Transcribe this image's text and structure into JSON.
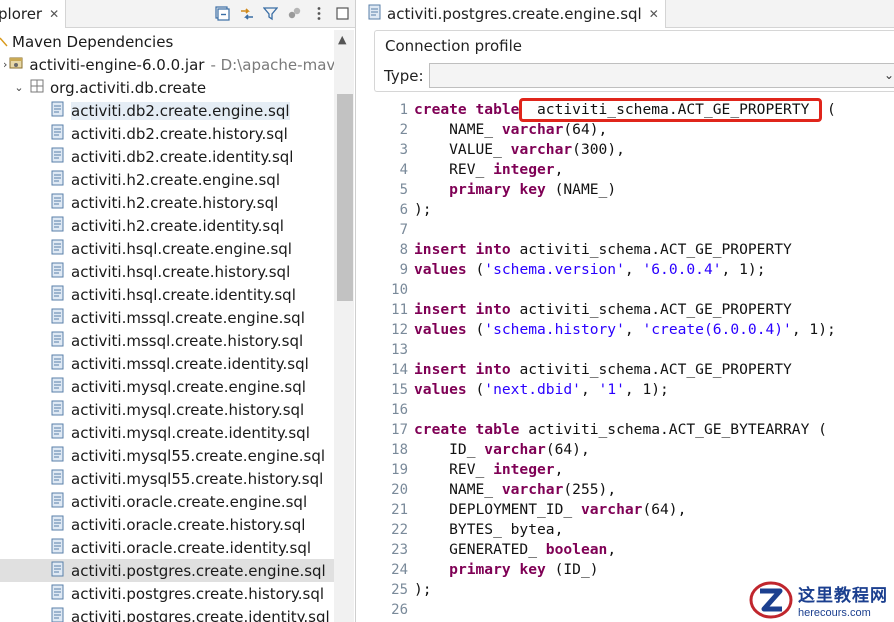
{
  "explorer": {
    "tab_title": "plorer",
    "tab_close": "✕",
    "tools": [
      "collapse-all-icon",
      "link-with-editor-icon",
      "filter-icon",
      "focus-icon",
      "view-menu-icon",
      "minimize-icon"
    ],
    "maven_label": "Maven Dependencies",
    "jar_label": "activiti-engine-6.0.0.jar",
    "jar_path": "- D:\\apache-maven",
    "package_label": "org.activiti.db.create",
    "files": [
      "activiti.db2.create.engine.sql",
      "activiti.db2.create.history.sql",
      "activiti.db2.create.identity.sql",
      "activiti.h2.create.engine.sql",
      "activiti.h2.create.history.sql",
      "activiti.h2.create.identity.sql",
      "activiti.hsql.create.engine.sql",
      "activiti.hsql.create.history.sql",
      "activiti.hsql.create.identity.sql",
      "activiti.mssql.create.engine.sql",
      "activiti.mssql.create.history.sql",
      "activiti.mssql.create.identity.sql",
      "activiti.mysql.create.engine.sql",
      "activiti.mysql.create.history.sql",
      "activiti.mysql.create.identity.sql",
      "activiti.mysql55.create.engine.sql",
      "activiti.mysql55.create.history.sql",
      "activiti.oracle.create.engine.sql",
      "activiti.oracle.create.history.sql",
      "activiti.oracle.create.identity.sql",
      "activiti.postgres.create.engine.sql",
      "activiti.postgres.create.history.sql",
      "activiti.postgres.create.identity.sql"
    ]
  },
  "editor": {
    "tab_title": "activiti.postgres.create.engine.sql",
    "tab_close": "✕",
    "connection_profile_label": "Connection profile",
    "type_label": "Type:",
    "type_value": "",
    "line_numbers": [
      "1",
      "2",
      "3",
      "4",
      "5",
      "6",
      "7",
      "8",
      "9",
      "10",
      "11",
      "12",
      "13",
      "14",
      "15",
      "16",
      "17",
      "18",
      "19",
      "20",
      "21",
      "22",
      "23",
      "24",
      "25",
      "26"
    ],
    "code": [
      [
        {
          "t": "kw",
          "v": "create table "
        },
        {
          "t": "p",
          "v": " activiti_schema.ACT_GE_PROPERTY  ("
        }
      ],
      [
        {
          "t": "p",
          "v": "    NAME_ "
        },
        {
          "t": "kw",
          "v": "varchar"
        },
        {
          "t": "p",
          "v": "(64),"
        }
      ],
      [
        {
          "t": "p",
          "v": "    VALUE_ "
        },
        {
          "t": "kw",
          "v": "varchar"
        },
        {
          "t": "p",
          "v": "(300),"
        }
      ],
      [
        {
          "t": "p",
          "v": "    REV_ "
        },
        {
          "t": "kw",
          "v": "integer"
        },
        {
          "t": "p",
          "v": ","
        }
      ],
      [
        {
          "t": "p",
          "v": "    "
        },
        {
          "t": "kw",
          "v": "primary key"
        },
        {
          "t": "p",
          "v": " (NAME_)"
        }
      ],
      [
        {
          "t": "p",
          "v": ");"
        }
      ],
      [],
      [
        {
          "t": "kw",
          "v": "insert into"
        },
        {
          "t": "p",
          "v": " activiti_schema.ACT_GE_PROPERTY"
        }
      ],
      [
        {
          "t": "kw",
          "v": "values"
        },
        {
          "t": "p",
          "v": " ("
        },
        {
          "t": "s",
          "v": "'schema.version'"
        },
        {
          "t": "p",
          "v": ", "
        },
        {
          "t": "s",
          "v": "'6.0.0.4'"
        },
        {
          "t": "p",
          "v": ", 1);"
        }
      ],
      [],
      [
        {
          "t": "kw",
          "v": "insert into"
        },
        {
          "t": "p",
          "v": " activiti_schema.ACT_GE_PROPERTY"
        }
      ],
      [
        {
          "t": "kw",
          "v": "values"
        },
        {
          "t": "p",
          "v": " ("
        },
        {
          "t": "s",
          "v": "'schema.history'"
        },
        {
          "t": "p",
          "v": ", "
        },
        {
          "t": "s",
          "v": "'create(6.0.0.4)'"
        },
        {
          "t": "p",
          "v": ", 1);"
        }
      ],
      [],
      [
        {
          "t": "kw",
          "v": "insert into"
        },
        {
          "t": "p",
          "v": " activiti_schema.ACT_GE_PROPERTY"
        }
      ],
      [
        {
          "t": "kw",
          "v": "values"
        },
        {
          "t": "p",
          "v": " ("
        },
        {
          "t": "s",
          "v": "'next.dbid'"
        },
        {
          "t": "p",
          "v": ", "
        },
        {
          "t": "s",
          "v": "'1'"
        },
        {
          "t": "p",
          "v": ", 1);"
        }
      ],
      [],
      [
        {
          "t": "kw",
          "v": "create table"
        },
        {
          "t": "p",
          "v": " activiti_schema.ACT_GE_BYTEARRAY ("
        }
      ],
      [
        {
          "t": "p",
          "v": "    ID_ "
        },
        {
          "t": "kw",
          "v": "varchar"
        },
        {
          "t": "p",
          "v": "(64),"
        }
      ],
      [
        {
          "t": "p",
          "v": "    REV_ "
        },
        {
          "t": "kw",
          "v": "integer"
        },
        {
          "t": "p",
          "v": ","
        }
      ],
      [
        {
          "t": "p",
          "v": "    NAME_ "
        },
        {
          "t": "kw",
          "v": "varchar"
        },
        {
          "t": "p",
          "v": "(255),"
        }
      ],
      [
        {
          "t": "p",
          "v": "    DEPLOYMENT_ID_ "
        },
        {
          "t": "kw",
          "v": "varchar"
        },
        {
          "t": "p",
          "v": "(64),"
        }
      ],
      [
        {
          "t": "p",
          "v": "    BYTES_ bytea,"
        }
      ],
      [
        {
          "t": "p",
          "v": "    GENERATED_ "
        },
        {
          "t": "kw",
          "v": "boolean"
        },
        {
          "t": "p",
          "v": ","
        }
      ],
      [
        {
          "t": "p",
          "v": "    "
        },
        {
          "t": "kw",
          "v": "primary key"
        },
        {
          "t": "p",
          "v": " (ID_)"
        }
      ],
      [
        {
          "t": "p",
          "v": ");"
        }
      ],
      []
    ]
  },
  "watermark": {
    "cn_text": "这里教程网",
    "en_text": "herecours.com"
  },
  "colors": {
    "keyword": "#7f0055",
    "string": "#2a00ff",
    "highlight_box": "#e0251b",
    "watermark": "#1b3f8f"
  }
}
